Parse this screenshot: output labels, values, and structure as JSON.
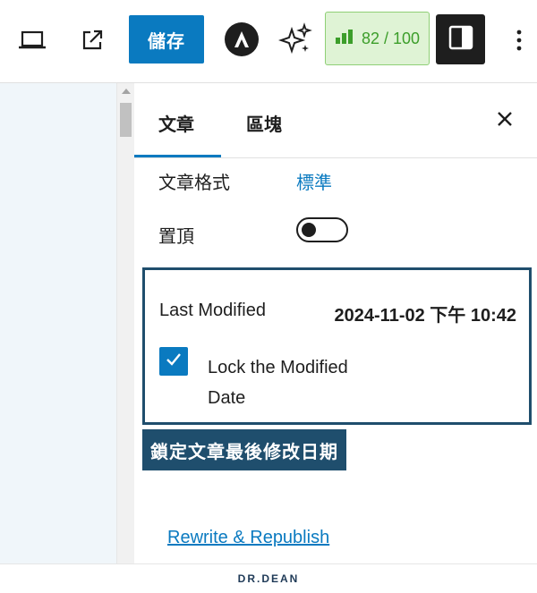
{
  "toolbar": {
    "save_label": "儲存",
    "seo_score": "82 / 100",
    "icons": [
      "desktop-preview-icon",
      "external-link-icon",
      "astra-logo-icon",
      "ai-sparkle-icon",
      "seo-chart-icon",
      "sidebar-toggle-icon",
      "more-options-icon"
    ]
  },
  "sidebar": {
    "tabs": [
      {
        "label": "文章",
        "active": true
      },
      {
        "label": "區塊",
        "active": false
      }
    ],
    "post_format_label": "文章格式",
    "post_format_value": "標準",
    "sticky_label": "置頂",
    "sticky_on": false,
    "last_modified_label": "Last Modified",
    "last_modified_value": "2024-11-02 下午 10:42",
    "lock_checkbox_label": "Lock the Modified Date",
    "lock_checked": true,
    "rewrite_link": "Rewrite & Republish"
  },
  "annotation": {
    "caption": "鎖定文章最後修改日期"
  },
  "footer": {
    "brand": "DR.DEAN"
  },
  "colors": {
    "accent": "#0a7ac0",
    "highlight": "#1f4e6d",
    "seo_green": "#3c9e2a"
  }
}
